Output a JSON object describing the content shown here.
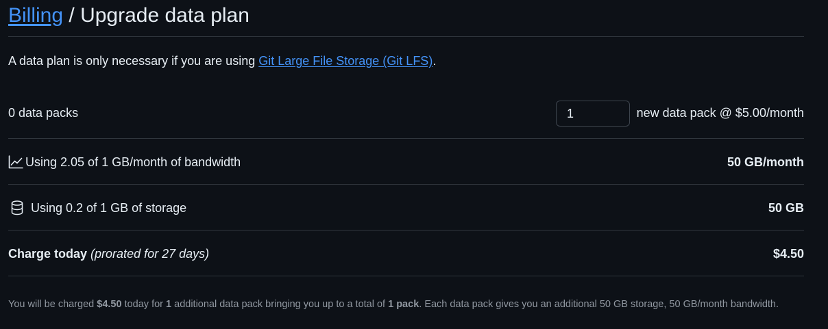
{
  "header": {
    "breadcrumb_link": "Billing",
    "separator": " / ",
    "title": "Upgrade data plan"
  },
  "intro": {
    "text": "A data plan is only necessary if you are using ",
    "link": "Git Large File Storage (Git LFS)",
    "suffix": "."
  },
  "packs": {
    "current": "0 data packs",
    "quantity_value": "1",
    "price_label": "new data pack @ $5.00/month"
  },
  "bandwidth": {
    "icon": "graph-icon",
    "label": "Using 2.05 of 1 GB/month of bandwidth",
    "value": "50 GB/month"
  },
  "storage": {
    "icon": "database-icon",
    "label": "Using 0.2 of 1 GB of storage",
    "value": "50 GB"
  },
  "charge": {
    "label": "Charge today",
    "note": "(prorated for 27 days)",
    "value": "$4.50"
  },
  "footnote": {
    "p1": "You will be charged ",
    "amount": "$4.50",
    "p2": " today for ",
    "count": "1",
    "p3": " additional data pack bringing you up to a total of ",
    "total": "1 pack",
    "p4": ". Each data pack gives you an additional 50 GB storage, 50 GB/month bandwidth."
  },
  "colors": {
    "background": "#0d1117",
    "text": "#e6edf3",
    "link": "#4493f8",
    "muted": "#9198a1",
    "border": "#30363d"
  }
}
